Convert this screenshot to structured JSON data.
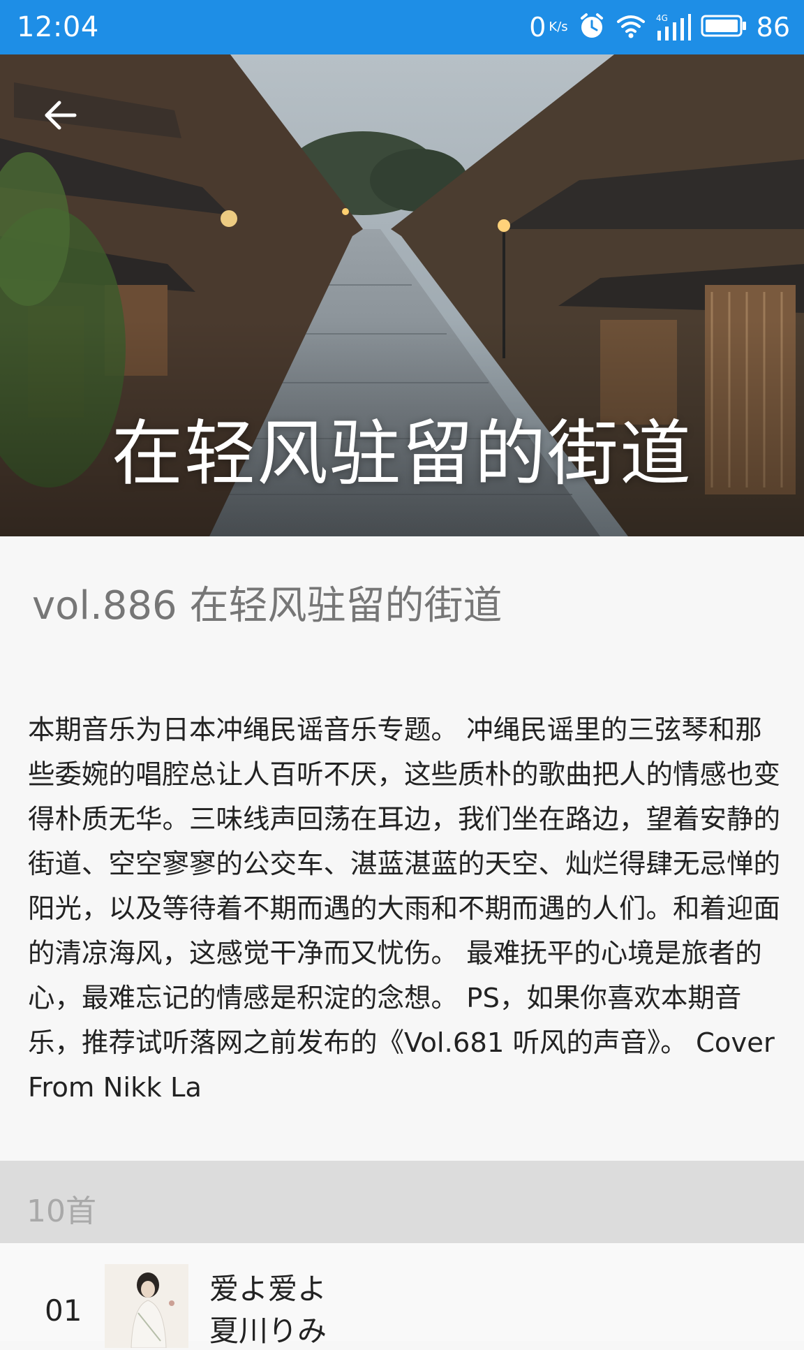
{
  "status_bar": {
    "time": "12:04",
    "net_speed": "0",
    "net_unit": "K/s",
    "signal_label": "4G",
    "battery": "86"
  },
  "header": {
    "title": "在轻风驻留的街道"
  },
  "article": {
    "vol_title": "vol.886 在轻风驻留的街道",
    "description": "本期音乐为日本冲绳民谣音乐专题。 冲绳民谣里的三弦琴和那些委婉的唱腔总让人百听不厌，这些质朴的歌曲把人的情感也变得朴质无华。三味线声回荡在耳边，我们坐在路边，望着安静的街道、空空寥寥的公交车、湛蓝湛蓝的天空、灿烂得肆无忌惮的阳光，以及等待着不期而遇的大雨和不期而遇的人们。和着迎面的清凉海风，这感觉干净而又忧伤。 最难抚平的心境是旅者的心，最难忘记的情感是积淀的念想。 PS，如果你喜欢本期音乐，推荐试听落网之前发布的《Vol.681 听风的声音》。 Cover From Nikk La"
  },
  "tracklist": {
    "count_label": "10首",
    "tracks": [
      {
        "number": "01",
        "name": "爱よ爱よ",
        "artist": "夏川りみ"
      }
    ]
  },
  "colors": {
    "status_bar": "#1e8ee6",
    "page_bg": "#f7f7f7",
    "count_bar": "#dcdcdc"
  }
}
